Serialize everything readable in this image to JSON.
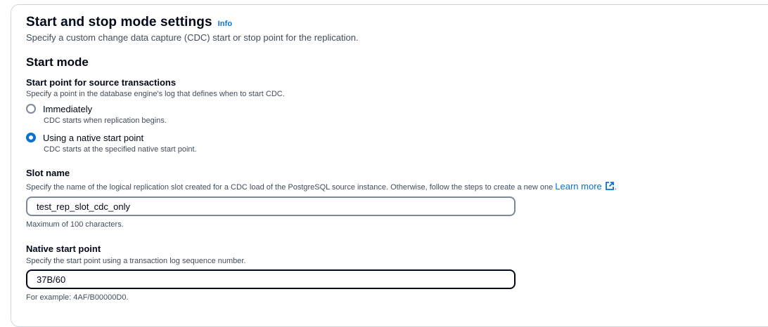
{
  "section": {
    "title": "Start and stop mode settings",
    "info_label": "Info",
    "description": "Specify a custom change data capture (CDC) start or stop point for the replication."
  },
  "start_mode": {
    "heading": "Start mode",
    "field_label": "Start point for source transactions",
    "field_description": "Specify a point in the database engine's log that defines when to start CDC.",
    "options": [
      {
        "label": "Immediately",
        "description": "CDC starts when replication begins.",
        "selected": false
      },
      {
        "label": "Using a native start point",
        "description": "CDC starts at the specified native start point.",
        "selected": true
      }
    ]
  },
  "slot_name": {
    "label": "Slot name",
    "description": "Specify the name of the logical replication slot created for a CDC load of the PostgreSQL source instance. Otherwise, follow the steps to create a new one",
    "learn_more": "Learn more",
    "trailing_period": ".",
    "value": "test_rep_slot_cdc_only",
    "constraint": "Maximum of 100 characters."
  },
  "native_start_point": {
    "label": "Native start point",
    "description": "Specify the start point using a transaction log sequence number.",
    "value": "37B/60",
    "hint": "For example: 4AF/B00000D0."
  },
  "colors": {
    "link": "#0972d3",
    "text": "#000716",
    "secondary_text": "#414d5c",
    "border": "#7d8998"
  },
  "icons": {
    "external_link": "external-link-icon"
  }
}
